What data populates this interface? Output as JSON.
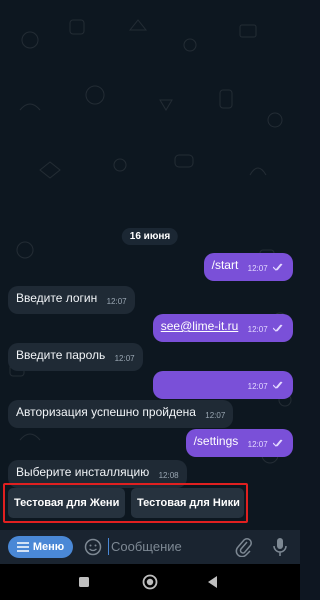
{
  "chat": {
    "date_label": "16 июня",
    "messages": [
      {
        "dir": "out",
        "text": "/start",
        "time": "12:07"
      },
      {
        "dir": "in",
        "text": "Введите логин",
        "time": "12:07"
      },
      {
        "dir": "out",
        "text": "see@lime-it.ru",
        "time": "12:07",
        "link": true
      },
      {
        "dir": "in",
        "text": "Введите пароль",
        "time": "12:07"
      },
      {
        "dir": "out",
        "text": "",
        "time": "12:07"
      },
      {
        "dir": "in",
        "text": "Авторизация успешно пройдена",
        "time": "12:07"
      },
      {
        "dir": "out",
        "text": "/settings",
        "time": "12:07"
      },
      {
        "dir": "in",
        "text": "Выберите инсталляцию",
        "time": "12:08"
      }
    ]
  },
  "keyboard": {
    "buttons": [
      "Тестовая для Жени",
      "Тестовая для Ники"
    ]
  },
  "input_bar": {
    "menu_label": "Меню",
    "placeholder": "Сообщение",
    "icons": [
      "menu-lines-icon",
      "emoji-icon",
      "attach-icon",
      "microphone-icon"
    ]
  },
  "navbar": {
    "icons": [
      "recents-square-icon",
      "home-circle-icon",
      "back-triangle-icon"
    ]
  },
  "colors": {
    "background": "#0d1720",
    "incoming_bubble": "#1f2a35",
    "outgoing_bubble": "#7a50d8",
    "accent": "#4a88d6",
    "highlight": "#e02020"
  }
}
